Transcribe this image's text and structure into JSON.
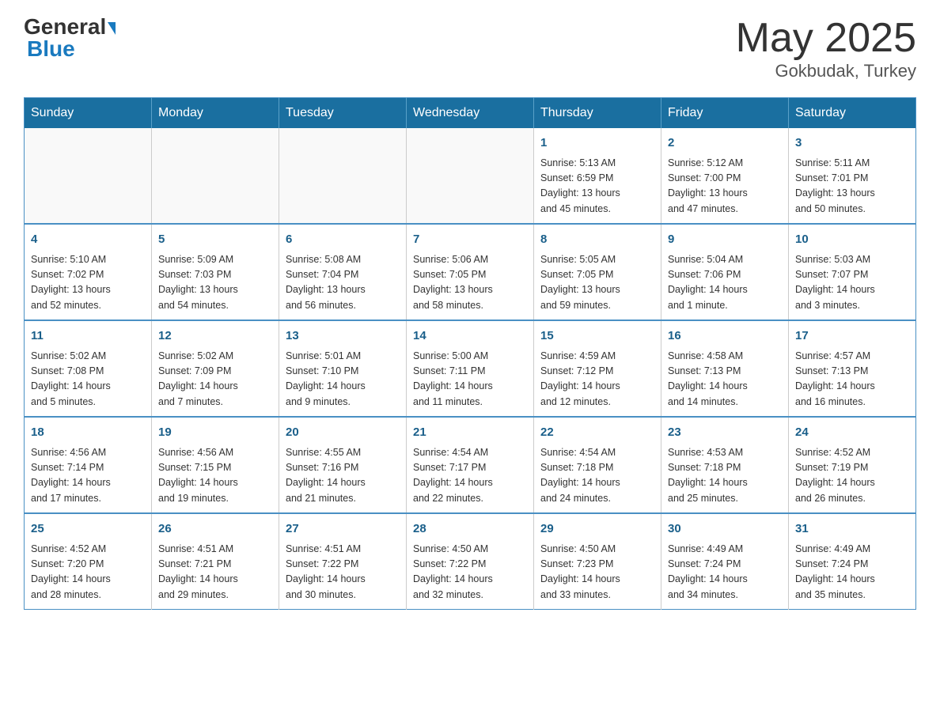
{
  "header": {
    "logo_general": "General",
    "logo_blue": "Blue",
    "title": "May 2025",
    "location": "Gokbudak, Turkey"
  },
  "days_of_week": [
    "Sunday",
    "Monday",
    "Tuesday",
    "Wednesday",
    "Thursday",
    "Friday",
    "Saturday"
  ],
  "weeks": [
    [
      {
        "day": "",
        "info": ""
      },
      {
        "day": "",
        "info": ""
      },
      {
        "day": "",
        "info": ""
      },
      {
        "day": "",
        "info": ""
      },
      {
        "day": "1",
        "info": "Sunrise: 5:13 AM\nSunset: 6:59 PM\nDaylight: 13 hours\nand 45 minutes."
      },
      {
        "day": "2",
        "info": "Sunrise: 5:12 AM\nSunset: 7:00 PM\nDaylight: 13 hours\nand 47 minutes."
      },
      {
        "day": "3",
        "info": "Sunrise: 5:11 AM\nSunset: 7:01 PM\nDaylight: 13 hours\nand 50 minutes."
      }
    ],
    [
      {
        "day": "4",
        "info": "Sunrise: 5:10 AM\nSunset: 7:02 PM\nDaylight: 13 hours\nand 52 minutes."
      },
      {
        "day": "5",
        "info": "Sunrise: 5:09 AM\nSunset: 7:03 PM\nDaylight: 13 hours\nand 54 minutes."
      },
      {
        "day": "6",
        "info": "Sunrise: 5:08 AM\nSunset: 7:04 PM\nDaylight: 13 hours\nand 56 minutes."
      },
      {
        "day": "7",
        "info": "Sunrise: 5:06 AM\nSunset: 7:05 PM\nDaylight: 13 hours\nand 58 minutes."
      },
      {
        "day": "8",
        "info": "Sunrise: 5:05 AM\nSunset: 7:05 PM\nDaylight: 13 hours\nand 59 minutes."
      },
      {
        "day": "9",
        "info": "Sunrise: 5:04 AM\nSunset: 7:06 PM\nDaylight: 14 hours\nand 1 minute."
      },
      {
        "day": "10",
        "info": "Sunrise: 5:03 AM\nSunset: 7:07 PM\nDaylight: 14 hours\nand 3 minutes."
      }
    ],
    [
      {
        "day": "11",
        "info": "Sunrise: 5:02 AM\nSunset: 7:08 PM\nDaylight: 14 hours\nand 5 minutes."
      },
      {
        "day": "12",
        "info": "Sunrise: 5:02 AM\nSunset: 7:09 PM\nDaylight: 14 hours\nand 7 minutes."
      },
      {
        "day": "13",
        "info": "Sunrise: 5:01 AM\nSunset: 7:10 PM\nDaylight: 14 hours\nand 9 minutes."
      },
      {
        "day": "14",
        "info": "Sunrise: 5:00 AM\nSunset: 7:11 PM\nDaylight: 14 hours\nand 11 minutes."
      },
      {
        "day": "15",
        "info": "Sunrise: 4:59 AM\nSunset: 7:12 PM\nDaylight: 14 hours\nand 12 minutes."
      },
      {
        "day": "16",
        "info": "Sunrise: 4:58 AM\nSunset: 7:13 PM\nDaylight: 14 hours\nand 14 minutes."
      },
      {
        "day": "17",
        "info": "Sunrise: 4:57 AM\nSunset: 7:13 PM\nDaylight: 14 hours\nand 16 minutes."
      }
    ],
    [
      {
        "day": "18",
        "info": "Sunrise: 4:56 AM\nSunset: 7:14 PM\nDaylight: 14 hours\nand 17 minutes."
      },
      {
        "day": "19",
        "info": "Sunrise: 4:56 AM\nSunset: 7:15 PM\nDaylight: 14 hours\nand 19 minutes."
      },
      {
        "day": "20",
        "info": "Sunrise: 4:55 AM\nSunset: 7:16 PM\nDaylight: 14 hours\nand 21 minutes."
      },
      {
        "day": "21",
        "info": "Sunrise: 4:54 AM\nSunset: 7:17 PM\nDaylight: 14 hours\nand 22 minutes."
      },
      {
        "day": "22",
        "info": "Sunrise: 4:54 AM\nSunset: 7:18 PM\nDaylight: 14 hours\nand 24 minutes."
      },
      {
        "day": "23",
        "info": "Sunrise: 4:53 AM\nSunset: 7:18 PM\nDaylight: 14 hours\nand 25 minutes."
      },
      {
        "day": "24",
        "info": "Sunrise: 4:52 AM\nSunset: 7:19 PM\nDaylight: 14 hours\nand 26 minutes."
      }
    ],
    [
      {
        "day": "25",
        "info": "Sunrise: 4:52 AM\nSunset: 7:20 PM\nDaylight: 14 hours\nand 28 minutes."
      },
      {
        "day": "26",
        "info": "Sunrise: 4:51 AM\nSunset: 7:21 PM\nDaylight: 14 hours\nand 29 minutes."
      },
      {
        "day": "27",
        "info": "Sunrise: 4:51 AM\nSunset: 7:22 PM\nDaylight: 14 hours\nand 30 minutes."
      },
      {
        "day": "28",
        "info": "Sunrise: 4:50 AM\nSunset: 7:22 PM\nDaylight: 14 hours\nand 32 minutes."
      },
      {
        "day": "29",
        "info": "Sunrise: 4:50 AM\nSunset: 7:23 PM\nDaylight: 14 hours\nand 33 minutes."
      },
      {
        "day": "30",
        "info": "Sunrise: 4:49 AM\nSunset: 7:24 PM\nDaylight: 14 hours\nand 34 minutes."
      },
      {
        "day": "31",
        "info": "Sunrise: 4:49 AM\nSunset: 7:24 PM\nDaylight: 14 hours\nand 35 minutes."
      }
    ]
  ]
}
